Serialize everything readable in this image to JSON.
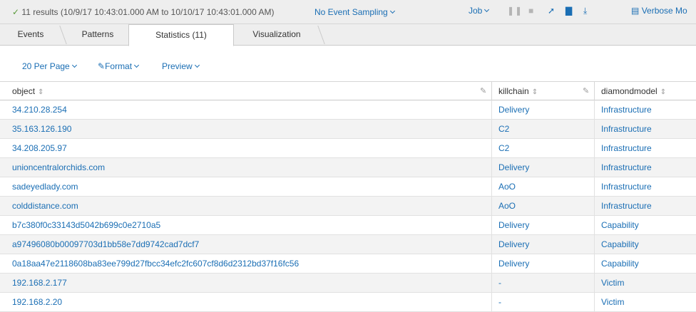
{
  "status": {
    "result_text": "11 results (10/9/17 10:43:01.000 AM to 10/10/17 10:43:01.000 AM)",
    "sampling": "No Event Sampling",
    "job": "Job",
    "mode": "Verbose Mo"
  },
  "tabs": [
    {
      "label": "Events"
    },
    {
      "label": "Patterns"
    },
    {
      "label": "Statistics (11)"
    },
    {
      "label": "Visualization"
    }
  ],
  "toolbar": {
    "per_page": "20 Per Page",
    "format": "Format",
    "preview": "Preview"
  },
  "table": {
    "columns": [
      "object",
      "killchain",
      "diamondmodel"
    ],
    "rows": [
      [
        "34.210.28.254",
        "Delivery",
        "Infrastructure"
      ],
      [
        "35.163.126.190",
        "C2",
        "Infrastructure"
      ],
      [
        "34.208.205.97",
        "C2",
        "Infrastructure"
      ],
      [
        "unioncentralorchids.com",
        "Delivery",
        "Infrastructure"
      ],
      [
        "sadeyedlady.com",
        "AoO",
        "Infrastructure"
      ],
      [
        "colddistance.com",
        "AoO",
        "Infrastructure"
      ],
      [
        "b7c380f0c33143d5042b699c0e2710a5",
        "Delivery",
        "Capability"
      ],
      [
        "a97496080b00097703d1bb58e7dd9742cad7dcf7",
        "Delivery",
        "Capability"
      ],
      [
        "0a18aa47e2118608ba83ee799d27fbcc34efc2fc607cf8d6d2312bd37f16fc56",
        "Delivery",
        "Capability"
      ],
      [
        "192.168.2.177",
        "-",
        "Victim"
      ],
      [
        "192.168.2.20",
        "-",
        "Victim"
      ]
    ]
  }
}
